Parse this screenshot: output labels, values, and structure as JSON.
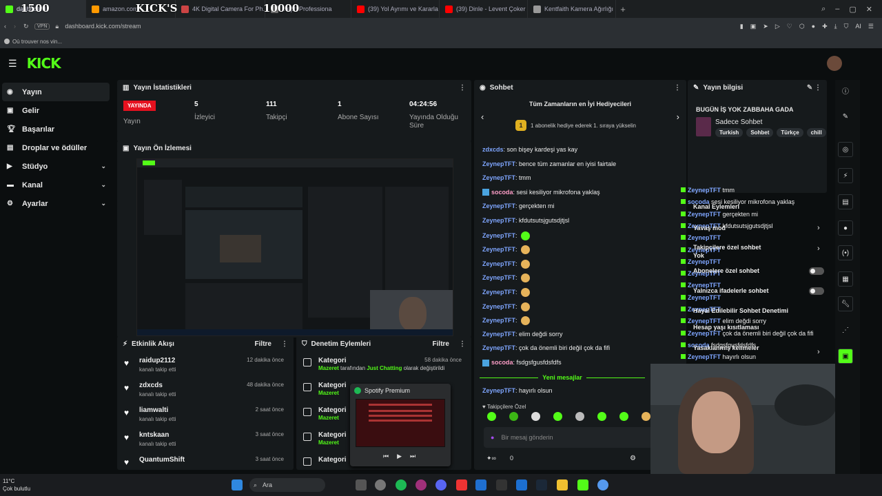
{
  "overlay": {
    "left_number": "1500",
    "center_label": "KICK'S",
    "center_number": "10000"
  },
  "browser": {
    "tabs": [
      "dashboard",
      "amazon.com",
      "4K Digital Camera For Ph...",
      "...ept: Professiona",
      "(39) Yol Ayrımı ve Kararla",
      "(39) Dinle - Levent Çoker",
      "Kentfaith Kamera Ağırlığı"
    ],
    "url": "dashboard.kick.com/stream",
    "vpn": "VPN",
    "bookmark": "Où trouver nos vin..."
  },
  "nav": {
    "logo": "KICK",
    "sidebar": [
      {
        "label": "Yayın",
        "icon": "stream-icon",
        "active": true,
        "expand": false
      },
      {
        "label": "Gelir",
        "icon": "revenue-icon",
        "active": false,
        "expand": false
      },
      {
        "label": "Başarılar",
        "icon": "trophy-icon",
        "active": false,
        "expand": false
      },
      {
        "label": "Droplar ve ödüller",
        "icon": "gift-icon",
        "active": false,
        "expand": false
      },
      {
        "label": "Stüdyo",
        "icon": "studio-icon",
        "active": false,
        "expand": true
      },
      {
        "label": "Kanal",
        "icon": "channel-icon",
        "active": false,
        "expand": true
      },
      {
        "label": "Ayarlar",
        "icon": "gear-icon",
        "active": false,
        "expand": true
      }
    ]
  },
  "stats": {
    "title": "Yayın İstatistikleri",
    "live_badge": "YAYINDA",
    "live_label": "Yayın",
    "items": [
      {
        "value": "5",
        "label": "İzleyici"
      },
      {
        "value": "111",
        "label": "Takipçi"
      },
      {
        "value": "1",
        "label": "Abone Sayısı"
      },
      {
        "value": "04:24:56",
        "label": "Yayında Olduğu Süre"
      }
    ]
  },
  "preview": {
    "title": "Yayın Ön İzlemesi"
  },
  "activity": {
    "title": "Etkinlik Akışı",
    "filter": "Filtre",
    "items": [
      {
        "name": "raidup2112",
        "sub": "kanalı takip etti",
        "time": "12 dakika önce"
      },
      {
        "name": "zdxcds",
        "sub": "kanalı takip etti",
        "time": "48 dakika önce"
      },
      {
        "name": "liamwalti",
        "sub": "kanalı takip etti",
        "time": "2 saat önce"
      },
      {
        "name": "kntskaan",
        "sub": "kanalı takip etti",
        "time": "3 saat önce"
      },
      {
        "name": "QuantumShift",
        "sub": "",
        "time": "3 saat önce"
      }
    ]
  },
  "moderation": {
    "title": "Denetim Eylemleri",
    "filter": "Filtre",
    "items": [
      {
        "cat": "Kategori",
        "who": "Mazeret",
        "mid": " tarafından ",
        "what": "Just Chatting",
        "tail": " olarak değiştirildi",
        "time": "58 dakika önce"
      },
      {
        "cat": "Kategori",
        "who": "Mazeret",
        "mid": "",
        "what": "",
        "tail": "",
        "time": ""
      },
      {
        "cat": "Kategori",
        "who": "Mazeret",
        "mid": "",
        "what": "",
        "tail": "",
        "time": ""
      },
      {
        "cat": "Kategori",
        "who": "Mazeret",
        "mid": "",
        "what": "",
        "tail": "",
        "time": ""
      },
      {
        "cat": "Kategori",
        "who": "",
        "mid": "",
        "what": "",
        "tail": "",
        "time": ""
      }
    ]
  },
  "spotify": {
    "title": "Spotify Premium"
  },
  "chat": {
    "title": "Sohbet",
    "gifters_title": "Tüm Zamanların en İyi Hediyecileri",
    "gifters_hint": "1 abonelik hediye ederek 1. sıraya yükselin",
    "gifters_rank": "1",
    "lines": [
      {
        "user": "zdxcds",
        "text": "son bişey kardeşi yas kay",
        "style": "u"
      },
      {
        "user": "ZeynepTFT",
        "text": "bence tüm zamanlar en iyisi fairtale",
        "style": "u"
      },
      {
        "user": "ZeynepTFT",
        "text": "tmm",
        "style": "u"
      },
      {
        "user": "socoda",
        "text": "sesi kesiliyor mikrofona yaklaş",
        "style": "u2"
      },
      {
        "user": "ZeynepTFT",
        "text": "gerçekten mi",
        "style": "u"
      },
      {
        "user": "ZeynepTFT",
        "text": "kfdutsutsjgutsdjtjsl",
        "style": "u"
      },
      {
        "user": "ZeynepTFT",
        "text": "",
        "style": "u",
        "emote": "#53fc18"
      },
      {
        "user": "ZeynepTFT",
        "text": "",
        "style": "u",
        "emote": "#e6b35a"
      },
      {
        "user": "ZeynepTFT",
        "text": "",
        "style": "u",
        "emote": "#e6b35a"
      },
      {
        "user": "ZeynepTFT",
        "text": "",
        "style": "u",
        "emote": "#e6b35a"
      },
      {
        "user": "ZeynepTFT",
        "text": "",
        "style": "u",
        "emote": "#e6b35a"
      },
      {
        "user": "ZeynepTFT",
        "text": "",
        "style": "u",
        "emote": "#e6b35a"
      },
      {
        "user": "ZeynepTFT",
        "text": "",
        "style": "u",
        "emote": "#e6b35a"
      },
      {
        "user": "ZeynepTFT",
        "text": "elim değdi sorry",
        "style": "u"
      },
      {
        "user": "ZeynepTFT",
        "text": "çok da önemli biri değil çok da fifi",
        "style": "u"
      },
      {
        "user": "socoda",
        "text": "fsdgsfgusfdsfdfs",
        "style": "u2"
      }
    ],
    "new_messages": "Yeni mesajlar",
    "last_line": {
      "user": "ZeynepTFT",
      "text": "hayırlı olsun"
    },
    "followers_only": "Takipçilere Özel",
    "input_placeholder": "Bir mesaj gönderin",
    "counter": "0"
  },
  "info": {
    "title": "Yayın bilgisi",
    "stream_title": "BUGÜN İŞ YOK ZABBAHA GADA",
    "category": "Sadece Sohbet",
    "tags": [
      "Turkish",
      "Sohbet",
      "Türkçe",
      "chill"
    ],
    "overlay_chat": [
      {
        "user": "ZeynepTFT",
        "text": "tmm"
      },
      {
        "user": "socoda",
        "text": "sesi kesiliyor mikrofona yaklaş"
      },
      {
        "user": "ZeynepTFT",
        "text": "gerçekten mi"
      },
      {
        "user": "ZeynepTFT",
        "text": "kfdutsutsjgutsdjtjsl"
      },
      {
        "user": "ZeynepTFT",
        "text": ""
      },
      {
        "user": "ZeynepTFT",
        "text": ""
      },
      {
        "user": "ZeynepTFT",
        "text": ""
      },
      {
        "user": "ZeynepTFT",
        "text": ""
      },
      {
        "user": "ZeynepTFT",
        "text": ""
      },
      {
        "user": "ZeynepTFT",
        "text": ""
      },
      {
        "user": "ZeynepTFT",
        "text": ""
      },
      {
        "user": "ZeynepTFT",
        "text": "elim değdi sorry"
      },
      {
        "user": "ZeynepTFT",
        "text": "çok da önemli biri değil çok da fifi"
      },
      {
        "user": "socoda",
        "text": "fsdgsfgusfdsfdfs"
      },
      {
        "user": "ZeynepTFT",
        "text": "hayırlı olsun"
      }
    ],
    "settings": [
      "Kanal Eylemleri",
      "Yavaş mod",
      "Takipçilere özel sohbet",
      "Yok",
      "Abonelere özel sohbet",
      "Yalnızca ifadelerle sohbet",
      "Hayal Edilebilir Sohbet Denetimi",
      "Hesap yaşı kısıtlaması",
      "Yasaklanmış kelimeler"
    ]
  },
  "taskbar": {
    "weather_temp": "11°C",
    "weather_desc": "Çok bulutlu",
    "search": "Ara"
  },
  "colors": {
    "kick_green": "#53fc18",
    "live_red": "#e5111f",
    "username_blue": "#7fa6ff"
  }
}
